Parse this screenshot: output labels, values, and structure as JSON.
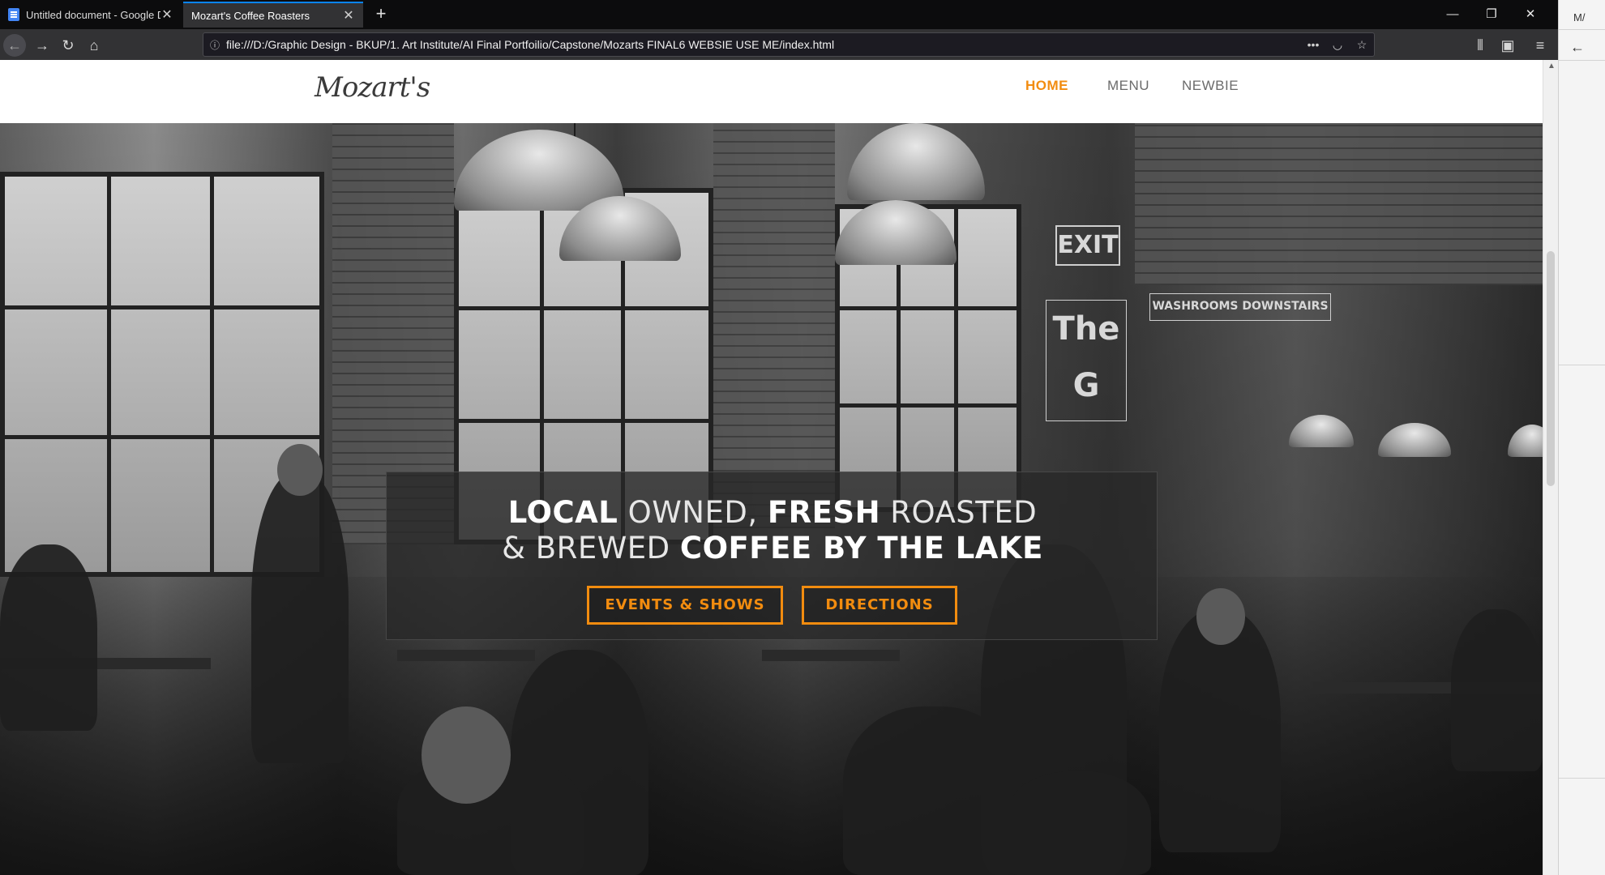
{
  "browser": {
    "tabs": [
      {
        "title": "Untitled document - Google D",
        "active": false
      },
      {
        "title": "Mozart's Coffee Roasters",
        "active": true
      }
    ],
    "new_tab": "+",
    "url": "file:///D:/Graphic Design - BKUP/1. Art Institute/AI Final Portfoilio/Capstone/Mozarts FINAL6 WEBSIE USE ME/index.html",
    "window_controls": {
      "minimize": "—",
      "restore": "❐",
      "close": "✕"
    },
    "icons": [
      "back-icon",
      "forward-icon",
      "reload-icon",
      "home-icon",
      "info-icon",
      "more-icon",
      "pocket-icon",
      "bookmark-star-icon",
      "library-icon",
      "sidebar-icon",
      "hamburger-menu-icon"
    ]
  },
  "second_window": {
    "tab_title": "M/"
  },
  "site": {
    "logo": "Mozart's",
    "nav": [
      {
        "label": "HOME",
        "active": true
      },
      {
        "label": "MENU",
        "active": false
      },
      {
        "label": "NEWBIE",
        "active": false
      }
    ],
    "hero": {
      "line1_bold_a": "LOCAL",
      "line1_thin_a": " OWNED, ",
      "line1_bold_b": "FRESH",
      "line1_thin_b": " ROASTED",
      "line2_thin": "& BREWED ",
      "line2_bold": "COFFEE BY THE LAKE",
      "buttons": [
        "EVENTS & SHOWS",
        "DIRECTIONS"
      ],
      "photo_signs": [
        "EXIT",
        "WASHROOMS DOWNSTAIRS",
        "The G"
      ]
    }
  },
  "colors": {
    "accent": "#f28c0f",
    "chrome_dark": "#0c0c0d",
    "chrome_toolbar": "#323234",
    "active_tab_line": "#0a84ff"
  }
}
